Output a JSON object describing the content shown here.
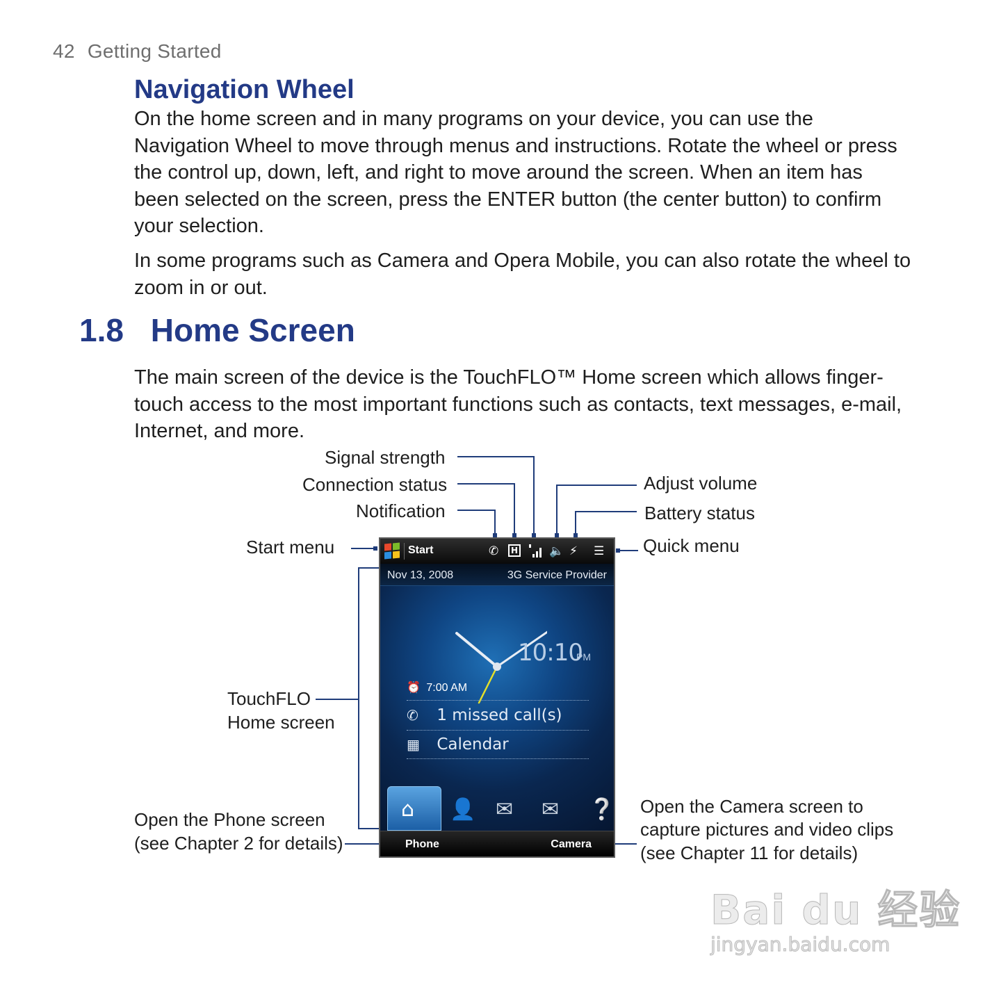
{
  "header": {
    "page_number": "42",
    "chapter": "Getting Started"
  },
  "navigation_wheel": {
    "title": "Navigation Wheel",
    "para1": "On the home screen and in many programs on your device, you can use the Navigation Wheel to move through menus and instructions. Rotate the wheel or press the control up, down, left, and right to move around the screen. When an item has been selected on the screen, press the ENTER button (the center button) to confirm your selection.",
    "para2": "In some programs such as Camera and Opera Mobile, you can also rotate the wheel to zoom in or out."
  },
  "home_screen_section": {
    "number": "1.8",
    "title": "Home Screen",
    "para": "The main screen of the device is the TouchFLO™ Home screen which allows finger-touch access to the most important functions such as contacts, text messages, e-mail, Internet, and more."
  },
  "callouts": {
    "signal_strength": "Signal strength",
    "connection_status": "Connection status",
    "notification": "Notification",
    "adjust_volume": "Adjust volume",
    "battery_status": "Battery status",
    "start_menu": "Start menu",
    "quick_menu": "Quick menu",
    "touchflo_line1": "TouchFLO",
    "touchflo_line2": "Home screen",
    "phone_line1": "Open the Phone screen",
    "phone_line2": "(see Chapter 2 for details)",
    "camera_line1": "Open the Camera screen to",
    "camera_line2": "capture pictures and video clips",
    "camera_line3": "(see Chapter 11 for details)"
  },
  "device_screen": {
    "start_label": "Start",
    "date": "Nov 13, 2008",
    "provider": "3G Service Provider",
    "time": "10:10",
    "ampm": "PM",
    "alarm": "7:00 AM",
    "missed_calls": "1 missed call(s)",
    "calendar": "Calendar",
    "softkey_left": "Phone",
    "softkey_right": "Camera",
    "icons": [
      "windows-logo-icon",
      "notification-icon",
      "connection-icon",
      "signal-icon",
      "volume-icon",
      "battery-icon",
      "quick-menu-icon",
      "alarm-icon",
      "phone-icon",
      "calendar-icon",
      "home-tab-icon",
      "contacts-tab-icon",
      "messages-tab-icon",
      "email-tab-icon",
      "more-tab-icon"
    ]
  },
  "watermark": {
    "brand": "Bai du 经验",
    "url": "jingyan.baidu.com"
  },
  "colors": {
    "heading_blue": "#233a86",
    "leader_line": "#1f3c7a",
    "text": "#1e1e1e",
    "page_header_gray": "#6e6e6e"
  }
}
